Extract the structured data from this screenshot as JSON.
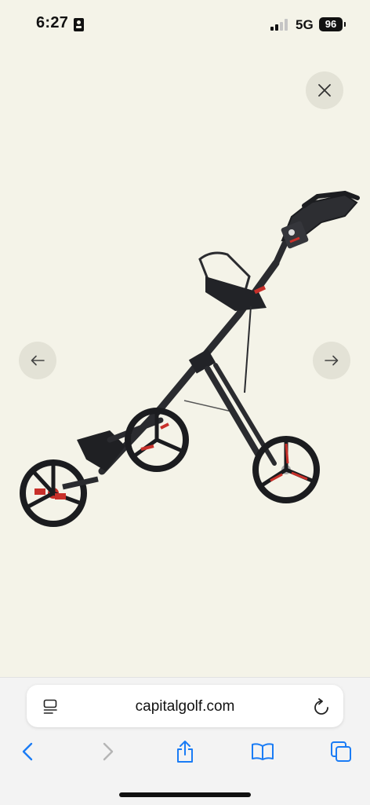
{
  "status_bar": {
    "time": "6:27",
    "network": "5G",
    "battery": "96",
    "signal_bars": 2
  },
  "viewer": {
    "close_icon": "close-icon",
    "prev_icon": "arrow-left-icon",
    "next_icon": "arrow-right-icon",
    "product_image": "three-wheel-golf-push-cart"
  },
  "browser": {
    "url": "capitalgolf.com",
    "reader_icon": "reader-mode-icon",
    "reload_icon": "reload-icon",
    "nav": [
      "back-icon",
      "forward-icon",
      "share-icon",
      "bookmarks-icon",
      "tabs-icon"
    ]
  },
  "colors": {
    "background": "#f4f3e8",
    "accent_blue": "#1a7cf5",
    "disabled": "#b5b5b5",
    "cart_frame": "#2a2b2f",
    "cart_red": "#c8302a"
  }
}
